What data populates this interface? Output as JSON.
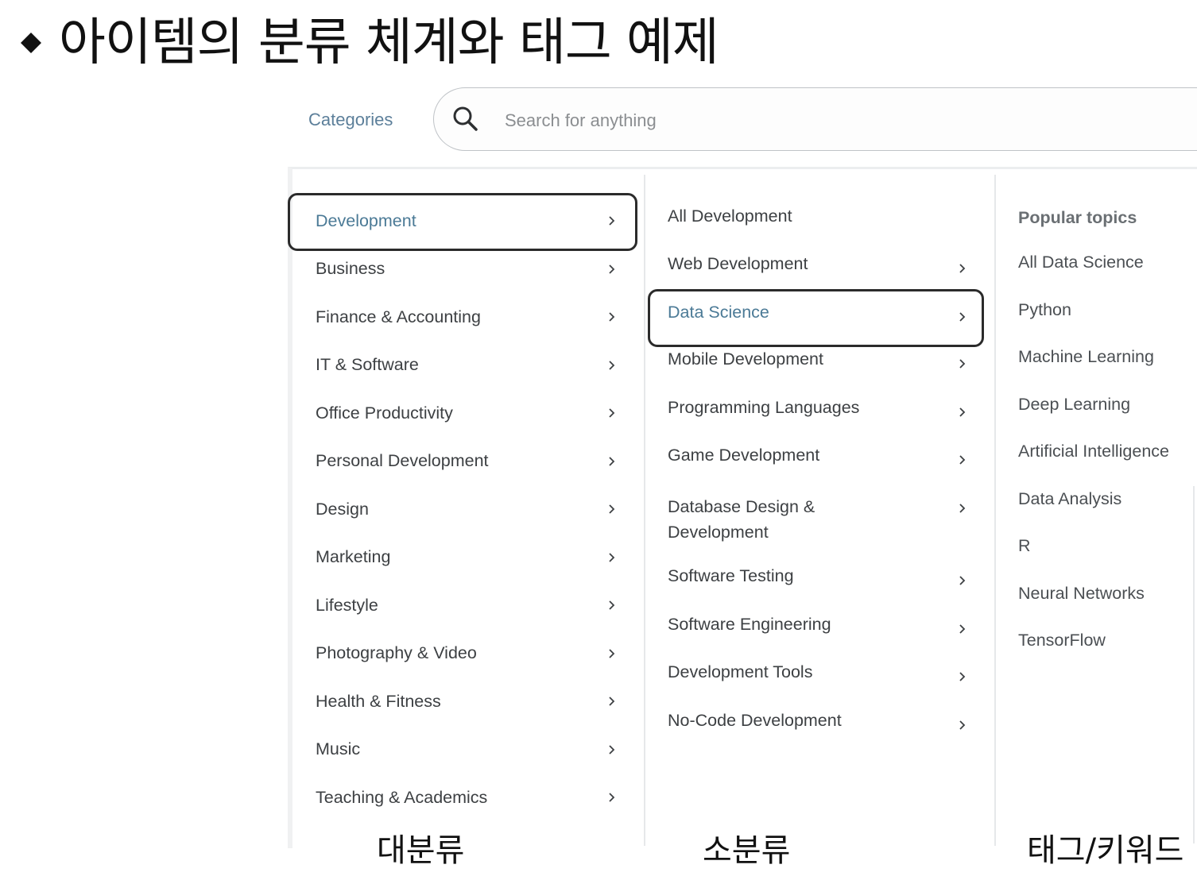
{
  "slide": {
    "title": "아이템의 분류 체계와 태그 예제"
  },
  "header": {
    "categories_label": "Categories",
    "search_placeholder": "Search for anything"
  },
  "categories": [
    {
      "label": "Development",
      "active": true
    },
    {
      "label": "Business"
    },
    {
      "label": "Finance & Accounting"
    },
    {
      "label": "IT & Software"
    },
    {
      "label": "Office Productivity"
    },
    {
      "label": "Personal Development"
    },
    {
      "label": "Design"
    },
    {
      "label": "Marketing"
    },
    {
      "label": "Lifestyle"
    },
    {
      "label": "Photography & Video"
    },
    {
      "label": "Health & Fitness"
    },
    {
      "label": "Music"
    },
    {
      "label": "Teaching & Academics"
    }
  ],
  "subcategories": [
    {
      "label": "All Development",
      "has_children": false
    },
    {
      "label": "Web Development",
      "has_children": true
    },
    {
      "label": "Data Science",
      "has_children": true,
      "active": true
    },
    {
      "label": "Mobile Development",
      "has_children": true
    },
    {
      "label": "Programming Languages",
      "has_children": true
    },
    {
      "label": "Game Development",
      "has_children": true
    },
    {
      "label": "Database Design & Development",
      "has_children": true
    },
    {
      "label": "Software Testing",
      "has_children": true
    },
    {
      "label": "Software Engineering",
      "has_children": true
    },
    {
      "label": "Development Tools",
      "has_children": true
    },
    {
      "label": "No-Code Development",
      "has_children": true
    }
  ],
  "topics": {
    "title": "Popular topics",
    "items": [
      "All Data Science",
      "Python",
      "Machine Learning",
      "Deep Learning",
      "Artificial Intelligence",
      "Data Analysis",
      "R",
      "Neural Networks",
      "TensorFlow"
    ]
  },
  "captions": {
    "main_category": "대분류",
    "sub_category": "소분류",
    "tags": "태그/키워드"
  },
  "colors": {
    "active_text": "#4b7a96",
    "link_text": "#5c7f9a",
    "highlight_border": "#2b2b2b"
  },
  "icons": {
    "bullet": "diamond-icon",
    "search": "search-icon",
    "chevron": "chevron-right-icon"
  }
}
